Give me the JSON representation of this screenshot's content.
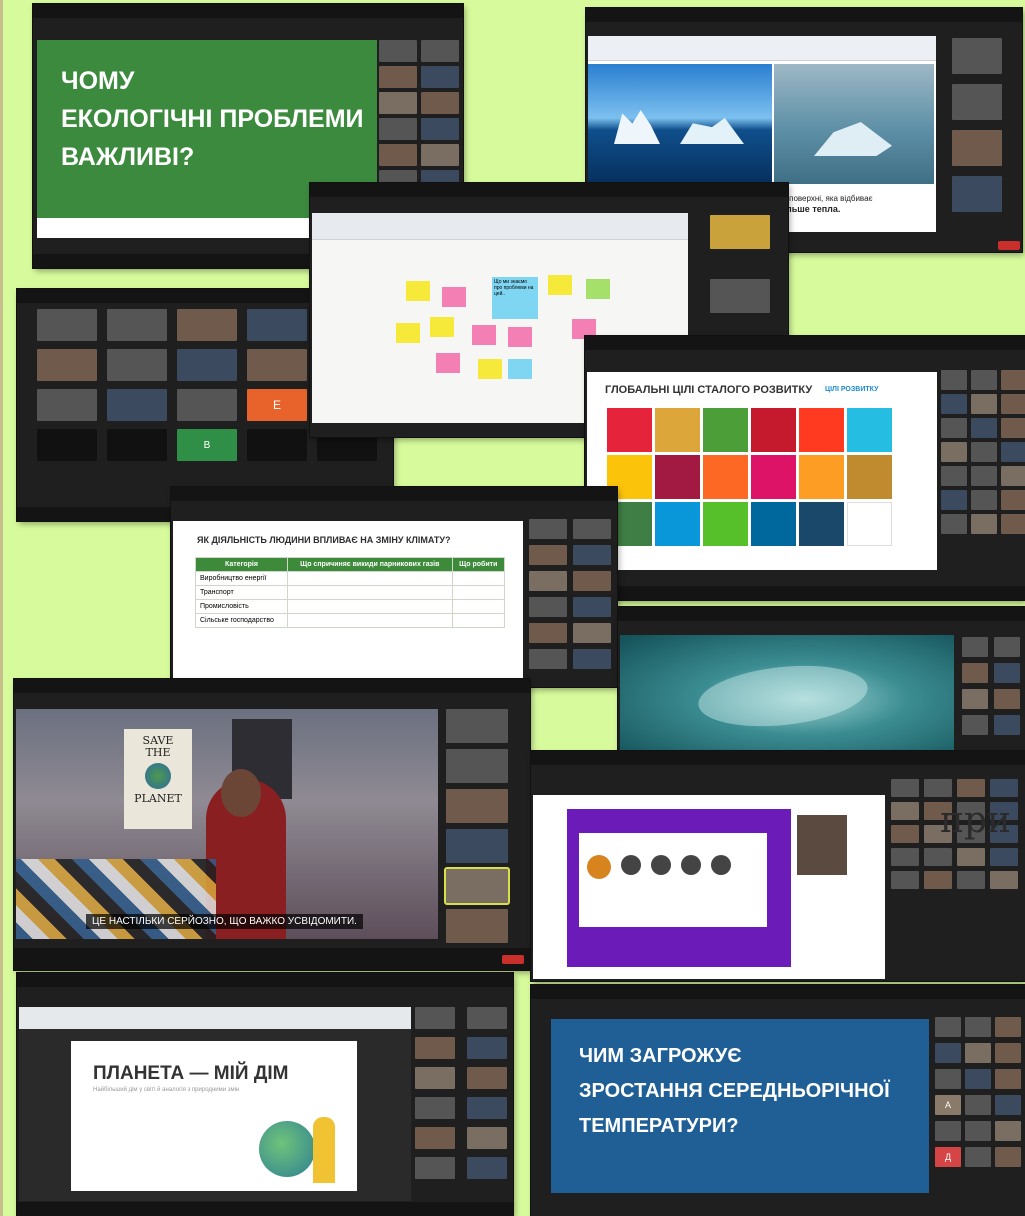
{
  "slides": {
    "green_slide": {
      "line1": "ЧОМУ",
      "line2": "ЕКОЛОГІЧНІ ПРОБЛЕМИ",
      "line3": "ВАЖЛИВІ?"
    },
    "iceberg_caption": {
      "line1": "...ї поверхні, яка відбиває",
      "line2": "більше тепла."
    },
    "jamboard_note": "Що ми знаємо про проблеми на цей..",
    "sdg": {
      "title": "ГЛОБАЛЬНІ ЦІЛІ СТАЛОГО РОЗВИТКУ",
      "un_label": "ЦІЛІ РОЗВИТКУ",
      "colors": [
        "#e5243b",
        "#dda63a",
        "#4c9f38",
        "#c5192d",
        "#ff3a21",
        "#26bde2",
        "#fcc30b",
        "#a21942",
        "#fd6925",
        "#dd1367",
        "#fd9d24",
        "#bf8b2e",
        "#3f7e44",
        "#0a97d9",
        "#56c02b",
        "#00689d",
        "#19486a",
        "#ffffff"
      ]
    },
    "climate_table": {
      "title": "ЯК ДІЯЛЬНІСТЬ ЛЮДИНИ ВПЛИВАЄ НА ЗМІНУ КЛІМАТУ?",
      "headers": [
        "Категорія",
        "Що спричиняє викиди парникових газів",
        "Що робити"
      ],
      "rows": [
        "Виробництво енергії",
        "Транспорт",
        "Промисловість",
        "Сільське господарство"
      ]
    },
    "video_subtitle": "ЦЕ НАСТІЛЬКИ СЕРЙОЗНО, ЩО ВАЖКО УСВІДОМИТИ.",
    "poster": {
      "line1": "SAVE",
      "line2": "THE",
      "line3": "PLANET"
    },
    "planet_slide": {
      "title": "ПЛАНЕТА — МІЙ ДІМ",
      "subtitle": "Найбільший дім у світі й аналогія з природними змін"
    },
    "blue_slide": {
      "line1": "ЧИМ ЗАГРОЖУЄ",
      "line2": "ЗРОСТАННЯ СЕРЕДНЬОРІЧНОЇ",
      "line3": "ТЕМПЕРАТУРИ?"
    },
    "participant_tile_letters": [
      "E",
      "B",
      "Д",
      "A",
      "Д"
    ]
  },
  "overlay_text": "при"
}
